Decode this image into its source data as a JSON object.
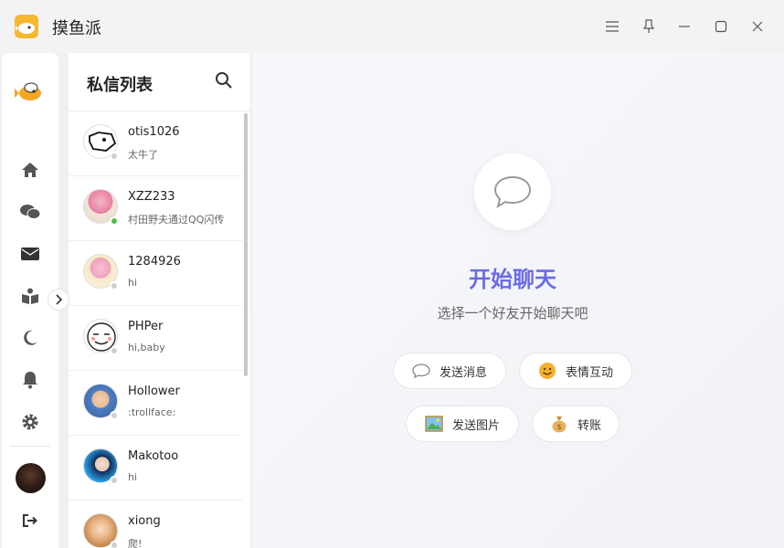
{
  "app": {
    "title": "摸鱼派"
  },
  "window_controls": [
    "menu-icon",
    "pin-icon",
    "minimize-icon",
    "maximize-icon",
    "close-icon"
  ],
  "nav": {
    "items": [
      "home-icon",
      "chat-bubbles-icon",
      "mail-icon",
      "book-reader-icon",
      "moon-icon",
      "bell-icon",
      "gear-icon",
      "logout-icon"
    ]
  },
  "list": {
    "title": "私信列表",
    "conversations": [
      {
        "name": "otis1026",
        "message": "太牛了",
        "online": false
      },
      {
        "name": "XZZ233",
        "message": "村田野夫通过QQ闪传",
        "online": true
      },
      {
        "name": "1284926",
        "message": "hi",
        "online": false
      },
      {
        "name": "PHPer",
        "message": "hi,baby",
        "online": false
      },
      {
        "name": "Hollower",
        "message": ":trollface:",
        "online": false
      },
      {
        "name": "Makotoo",
        "message": "hi",
        "online": false
      },
      {
        "name": "xiong",
        "message": "爬!",
        "online": false
      }
    ]
  },
  "chat": {
    "title": "开始聊天",
    "subtitle": "选择一个好友开始聊天吧",
    "actions": {
      "send_message": "发送消息",
      "emoji": "表情互动",
      "send_image": "发送图片",
      "transfer": "转账"
    }
  },
  "colors": {
    "accent": "#6a6be8",
    "online": "#4cc24c",
    "logo": "#f5b82e"
  }
}
